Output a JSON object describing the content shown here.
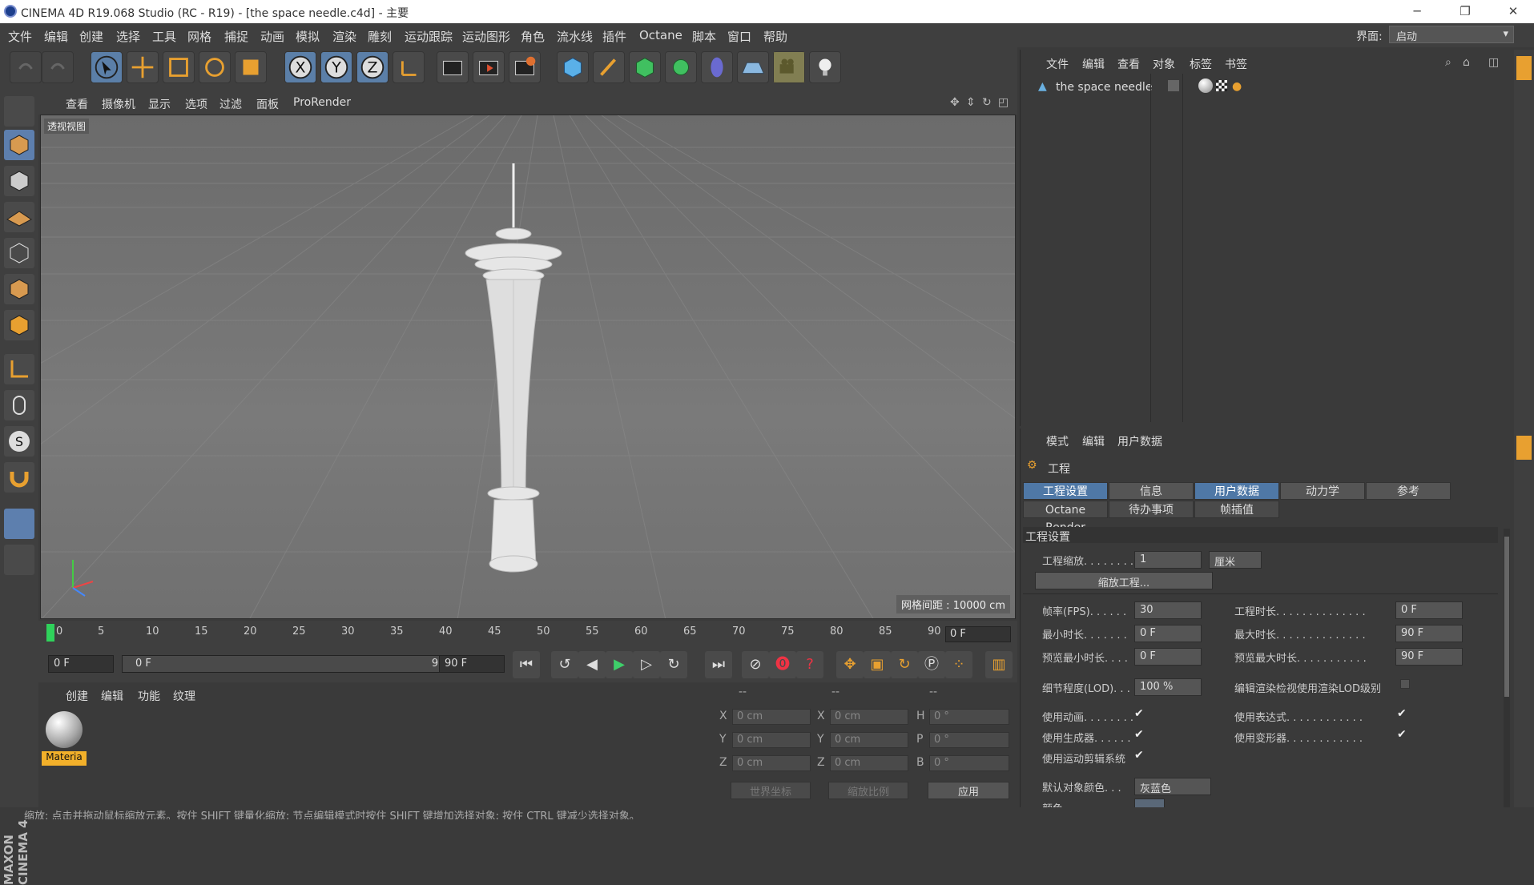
{
  "window": {
    "title": "CINEMA 4D R19.068 Studio (RC - R19) - [the space needle.c4d] - 主要"
  },
  "menu": [
    "文件",
    "编辑",
    "创建",
    "选择",
    "工具",
    "网格",
    "捕捉",
    "动画",
    "模拟",
    "渲染",
    "雕刻",
    "运动跟踪",
    "运动图形",
    "角色",
    "流水线",
    "插件",
    "Octane",
    "脚本",
    "窗口",
    "帮助"
  ],
  "interface": {
    "label": "界面:",
    "value": "启动"
  },
  "viewport": {
    "menu": [
      "查看",
      "摄像机",
      "显示",
      "选项",
      "过滤",
      "面板",
      "ProRender"
    ],
    "label": "透视视图",
    "grid_info": "网格间距 : 10000 cm"
  },
  "timeline": {
    "ticks": [
      "0",
      "5",
      "10",
      "15",
      "20",
      "25",
      "30",
      "35",
      "40",
      "45",
      "50",
      "55",
      "60",
      "65",
      "70",
      "75",
      "80",
      "85",
      "90"
    ],
    "current": "0 F"
  },
  "playback": {
    "start": "0 F",
    "range_start": "0 F",
    "range_end": "90 F",
    "end": "90 F"
  },
  "material_manager": {
    "menu": [
      "创建",
      "编辑",
      "功能",
      "纹理"
    ],
    "material_name": "Materia"
  },
  "coords": {
    "headers": [
      "--",
      "--",
      "--"
    ],
    "rows": [
      {
        "a": "X",
        "av": "0 cm",
        "b": "X",
        "bv": "0 cm",
        "c": "H",
        "cv": "0 °"
      },
      {
        "a": "Y",
        "av": "0 cm",
        "b": "Y",
        "bv": "0 cm",
        "c": "P",
        "cv": "0 °"
      },
      {
        "a": "Z",
        "av": "0 cm",
        "b": "Z",
        "bv": "0 cm",
        "c": "B",
        "cv": "0 °"
      }
    ],
    "world": "世界坐标",
    "scale": "缩放比例",
    "apply": "应用"
  },
  "object_manager": {
    "menu": [
      "文件",
      "编辑",
      "查看",
      "对象",
      "标签",
      "书签"
    ],
    "object_name": "the space needle"
  },
  "attributes": {
    "menu": [
      "模式",
      "编辑",
      "用户数据"
    ],
    "section": "工程",
    "tabs_row1": [
      "工程设置",
      "信息",
      "用户数据",
      "动力学",
      "参考"
    ],
    "tabs_row2": [
      "Octane Render",
      "待办事项",
      "帧插值"
    ],
    "group_title": "工程设置",
    "scale_label": "工程缩放. . . . . . . .",
    "scale_value": "1",
    "scale_unit": "厘米",
    "scale_button": "缩放工程...",
    "fps_label": "帧率(FPS). . . . . .",
    "fps_value": "30",
    "duration_label": "工程时长. . . . . . . . . . . . . .",
    "duration_value": "0 F",
    "min_label": "最小时长. . . . . . .",
    "min_value": "0 F",
    "max_label": "最大时长. . . . . . . . . . . . . .",
    "max_value": "90 F",
    "pmin_label": "预览最小时长. . . .",
    "pmin_value": "0 F",
    "pmax_label": "预览最大时长. . . . . . . . . . .",
    "pmax_value": "90 F",
    "lod_label": "细节程度(LOD). . .",
    "lod_value": "100 %",
    "lod_render_label": "编辑渲染检视使用渲染LOD级别",
    "anim_label": "使用动画. . . . . . . .",
    "expr_label": "使用表达式. . . . . . . . . . . .",
    "gen_label": "使用生成器. . . . . .",
    "deform_label": "使用变形器. . . . . . . . . . . .",
    "motion_label": "使用运动剪辑系统",
    "color_label": "默认对象颜色. . .",
    "color_value": "灰蓝色",
    "color2_label": "颜色. . . . . . . . ."
  },
  "status": "缩放: 点击并拖动鼠标缩放元素。按住 SHIFT 键量化缩放; 节点编辑模式时按住 SHIFT 键增加选择对象; 按住 CTRL 键减少选择对象。",
  "brand": "MAXON CINEMA 4D"
}
